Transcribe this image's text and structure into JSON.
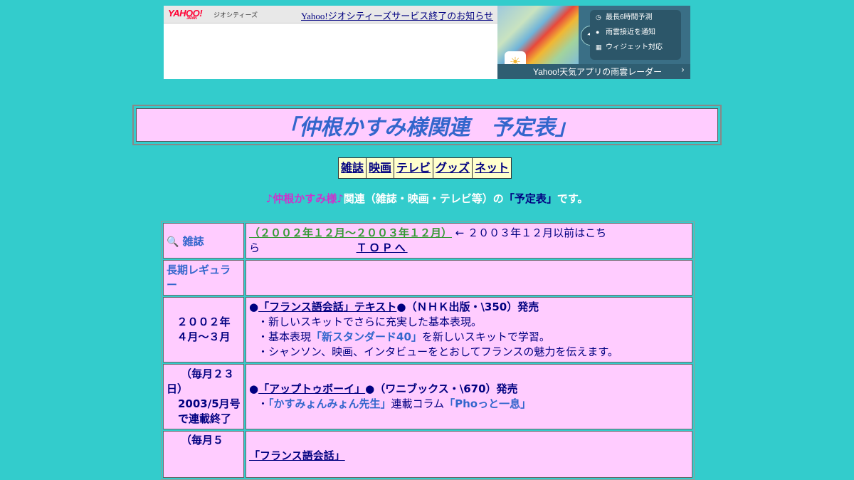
{
  "ad": {
    "logo": "YAHOO!",
    "logo_sub": "JAPAN",
    "geocities": "ジオシティーズ",
    "notice": "Yahoo!ジオシティーズサービス終了のお知らせ",
    "features": [
      "最長6時間予測",
      "雨雲接近を通知",
      "ウィジェット対応"
    ],
    "bottom_text": "Yahoo!天気アプリの雨雲レーダー",
    "chevron": "›"
  },
  "title": "「仲根かすみ様関連　予定表」",
  "nav": [
    "雑誌",
    "映画",
    "テレビ",
    "グッズ",
    "ネット"
  ],
  "intro": {
    "name": "♪仲根かすみ様♪",
    "middle": "関連（雑誌・映画・テレビ等）の",
    "highlight": "「予定表」",
    "end": "です。"
  },
  "table": {
    "header_label": "雑誌",
    "header_period": "（２００２年１２月～２００３年１２月）",
    "header_before": "← ２００３年１２月以前はこち",
    "header_before2": "ら",
    "header_top": "ＴＯＰへ",
    "regular_label": "長期レギュラー",
    "rows": [
      {
        "label1": "２００２年",
        "label2": "４月～３月",
        "bullet": "●",
        "title": "「フランス語会話」テキスト",
        "detail": "●（ＮＨＫ出版・\\350）発売",
        "lines": [
          {
            "pre": "・新しいスキットでさらに充実した基本表現。"
          },
          {
            "pre": "・基本表現",
            "hl": "「新スタンダード40」",
            "post": "を新しいスキットで学習。"
          },
          {
            "pre": "・シャンソン、映画、インタビューをとおしてフランスの魅力を伝えます。"
          }
        ]
      },
      {
        "label1": "（毎月２３日）",
        "label2": "2003/5月号",
        "label3": "で連載終了",
        "bullet": "●",
        "title": "「アップトゥボーイ」",
        "detail": "●（ワニブックス・\\670）発売",
        "lines": [
          {
            "pre": "・",
            "hl": "「かすみょんみょん先生」",
            "post": "連載コラム",
            "hl2": "「Phoっと一息」"
          }
        ]
      },
      {
        "label1": "（毎月５",
        "title": "「フランス語会話」"
      }
    ]
  }
}
